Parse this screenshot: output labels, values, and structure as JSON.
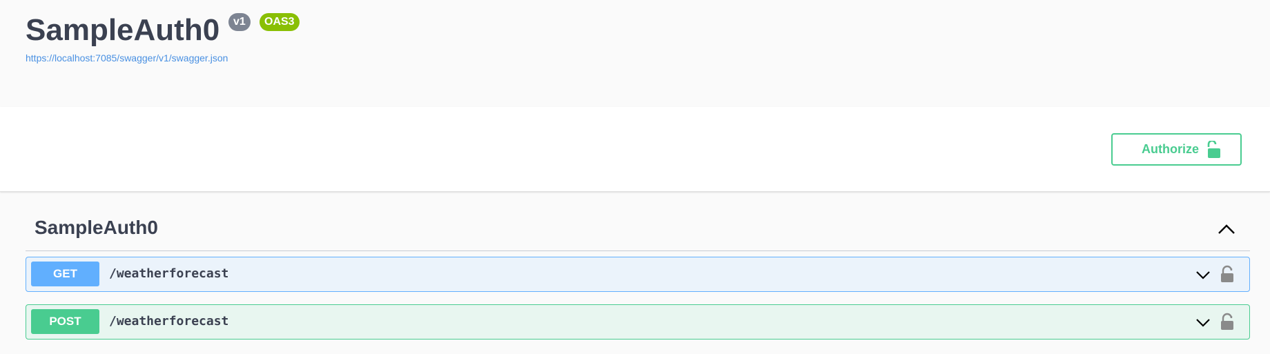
{
  "info": {
    "title": "SampleAuth0",
    "version_badge": "v1",
    "oas_badge": "OAS3",
    "spec_url": "https://localhost:7085/swagger/v1/swagger.json"
  },
  "scheme": {
    "authorize_label": "Authorize"
  },
  "tag": {
    "name": "SampleAuth0",
    "operations": [
      {
        "method": "GET",
        "path": "/weatherforecast"
      },
      {
        "method": "POST",
        "path": "/weatherforecast"
      }
    ]
  },
  "colors": {
    "get": "#61affe",
    "post": "#49cc90",
    "badge_version": "#7d8492",
    "badge_oas": "#89bf04",
    "link": "#4990e2"
  },
  "icons": [
    "unlock-icon",
    "chevron-up-icon",
    "chevron-down-icon",
    "lock-icon"
  ]
}
